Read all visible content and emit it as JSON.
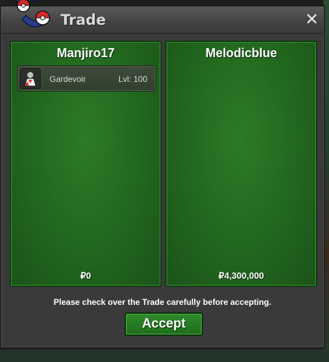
{
  "window": {
    "title": "Trade",
    "close_icon": "close-icon",
    "accent_color": "#236a20"
  },
  "left_panel": {
    "player": "Manjiro17",
    "items": [
      {
        "icon": "gardevoir-sprite-icon",
        "name": "Gardevoir",
        "level": "Lvl: 100"
      }
    ],
    "money": "₽0"
  },
  "right_panel": {
    "player": "Melodicblue",
    "items": [],
    "money": "₽4,300,000"
  },
  "footer": {
    "notice": "Please check over the Trade carefully before accepting.",
    "accept_label": "Accept"
  }
}
